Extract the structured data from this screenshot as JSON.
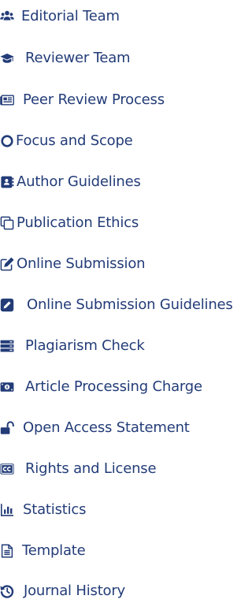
{
  "theme": {
    "link_color": "#233c78"
  },
  "menu": {
    "items": [
      {
        "label": "Editorial Team",
        "icon": "users-icon"
      },
      {
        "label": "Reviewer Team",
        "icon": "graduation-cap-icon"
      },
      {
        "label": "Peer Review Process",
        "icon": "newspaper-icon"
      },
      {
        "label": "Focus and Scope",
        "icon": "circle-icon"
      },
      {
        "label": "Author Guidelines",
        "icon": "address-book-icon"
      },
      {
        "label": "Publication Ethics",
        "icon": "clone-icon"
      },
      {
        "label": "Online Submission",
        "icon": "edit-icon"
      },
      {
        "label": "Online Submission Guidelines",
        "icon": "pencil-square-icon"
      },
      {
        "label": "Plagiarism Check",
        "icon": "server-icon"
      },
      {
        "label": "Article Processing Charge",
        "icon": "money-bill-icon"
      },
      {
        "label": "Open Access Statement",
        "icon": "unlock-icon"
      },
      {
        "label": "Rights and License",
        "icon": "creative-commons-icon"
      },
      {
        "label": "Statistics",
        "icon": "chart-bar-icon"
      },
      {
        "label": "Template",
        "icon": "file-text-icon"
      },
      {
        "label": "Journal History",
        "icon": "history-icon"
      }
    ]
  }
}
